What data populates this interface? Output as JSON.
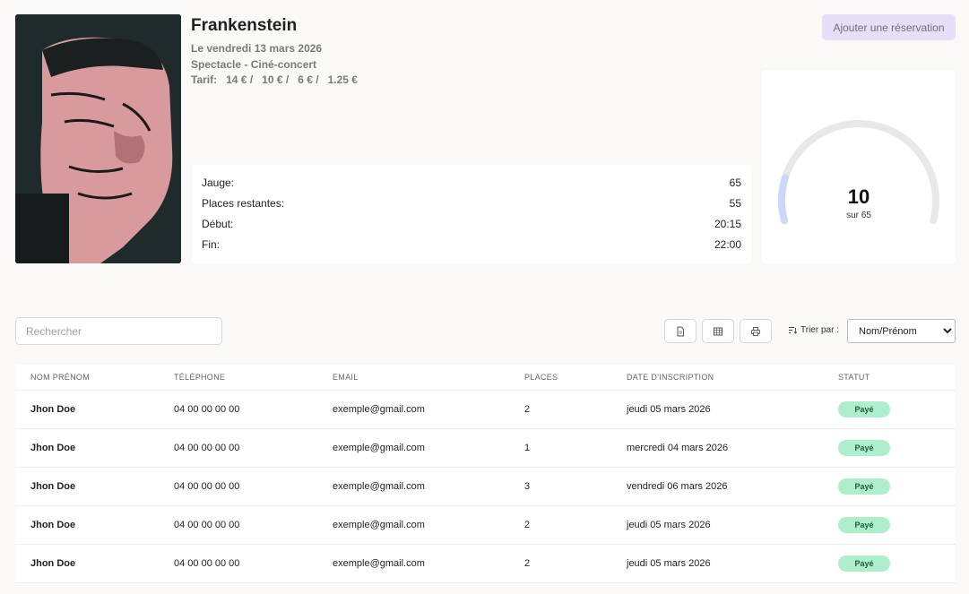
{
  "event": {
    "title": "Frankenstein",
    "date": "Le vendredi 13 mars 2026",
    "category": "Spectacle - Ciné-concert",
    "tarif_label": "Tarif:",
    "tarifs": [
      "14 € /",
      "10 € /",
      "6 € /",
      "1.25 €"
    ]
  },
  "actions": {
    "add_reservation": "Ajouter une réservation"
  },
  "info": [
    {
      "label": "Jauge:",
      "value": "65"
    },
    {
      "label": "Places restantes:",
      "value": "55"
    },
    {
      "label": "Début:",
      "value": "20:15"
    },
    {
      "label": "Fin:",
      "value": "22:00"
    }
  ],
  "gauge": {
    "value": "10",
    "caption": "sur 65",
    "current": 10,
    "max": 65,
    "track_color": "#e8e8ea",
    "fill_color": "#c9d9f7"
  },
  "toolbar": {
    "search_placeholder": "Rechercher",
    "icons": [
      "file-icon",
      "table-icon",
      "print-icon"
    ],
    "sort_label": "Trier par :",
    "sort_selected": "Nom/Prénom"
  },
  "table": {
    "headers": [
      "NOM PRÉNOM",
      "TÉLÉPHONE",
      "EMAIL",
      "PLACES",
      "DATE D'INSCRIPTION",
      "STATUT"
    ],
    "rows": [
      [
        "Jhon Doe",
        "04 00 00 00 00",
        "exemple@gmail.com",
        "2",
        "jeudi 05 mars 2026",
        "Payé"
      ],
      [
        "Jhon Doe",
        "04 00 00 00 00",
        "exemple@gmail.com",
        "1",
        "mercredi 04 mars 2026",
        "Payé"
      ],
      [
        "Jhon Doe",
        "04 00 00 00 00",
        "exemple@gmail.com",
        "3",
        "vendredi 06 mars 2026",
        "Payé"
      ],
      [
        "Jhon Doe",
        "04 00 00 00 00",
        "exemple@gmail.com",
        "2",
        "jeudi 05 mars 2026",
        "Payé"
      ],
      [
        "Jhon Doe",
        "04 00 00 00 00",
        "exemple@gmail.com",
        "2",
        "jeudi 05 mars 2026",
        "Payé"
      ]
    ]
  }
}
